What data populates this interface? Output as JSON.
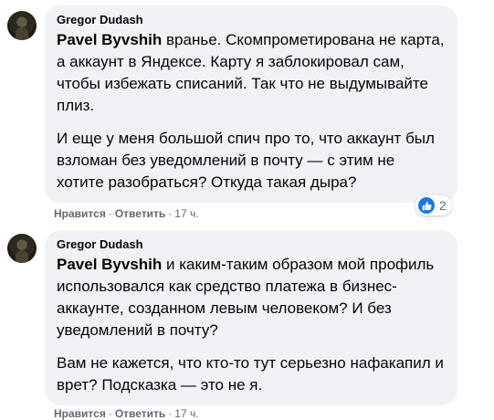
{
  "comments": [
    {
      "author": "Gregor Dudash",
      "mention": "Pavel Byvshih",
      "para1_rest": " вранье. Скомпрометирована не карта, а аккаунт в Яндексе. Карту я заблокировал сам, чтобы избежать списаний. Так что не выдумывайте плиз.",
      "para2": "И еще у меня большой спич про то, что аккаунт был взломан без уведомлений в почту — с этим не хотите разобраться? Откуда такая дыра?",
      "like_label": "Нравится",
      "separator": "·",
      "reply_label": "Ответить",
      "time": "17 ч.",
      "reaction_count": "2",
      "reaction_icon": "like-icon",
      "accent": "#1877f2"
    },
    {
      "author": "Gregor Dudash",
      "mention": "Pavel Byvshih",
      "para1_rest": " и каким-таким образом мой профиль использовался как средство платежа в бизнес-аккаунте, созданном левым человеком? И без уведомлений в почту?",
      "para2": "Вам не кажется, что кто-то тут серьезно нафакапил и врет? Подсказка — это не я.",
      "like_label": "Нравится",
      "separator": "·",
      "reply_label": "Ответить",
      "time": "17 ч."
    }
  ]
}
